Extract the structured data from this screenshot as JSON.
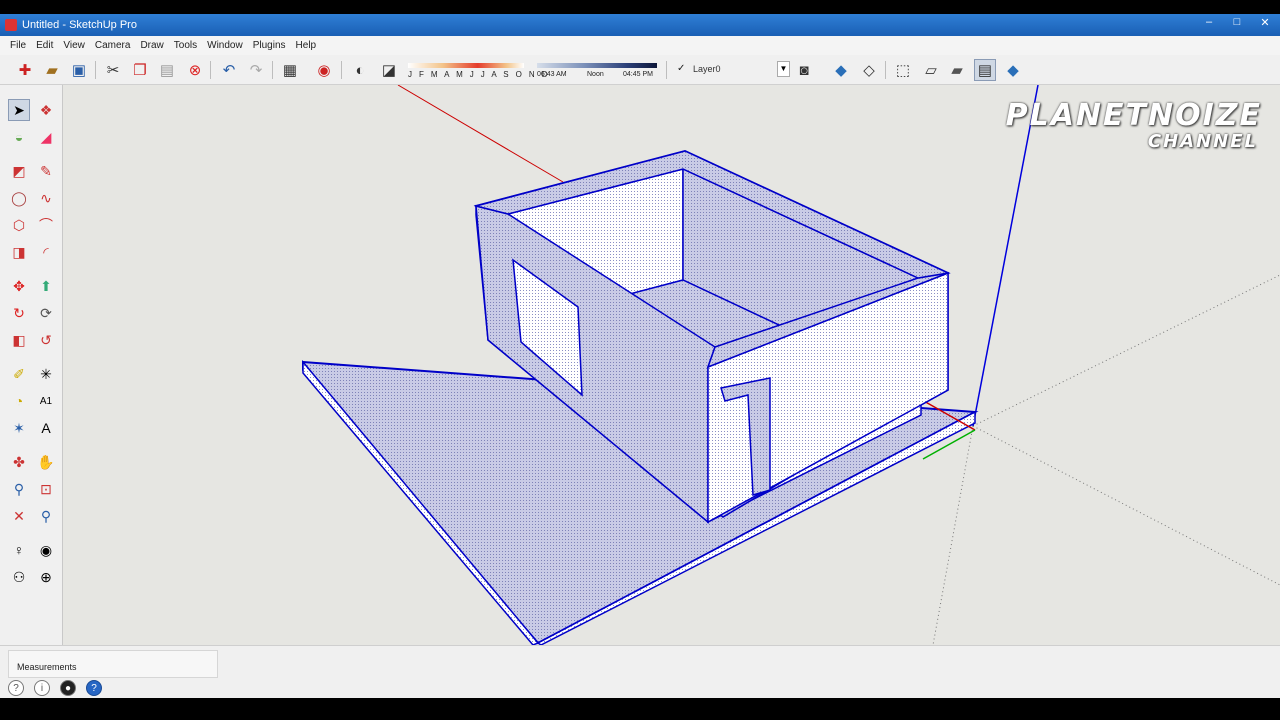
{
  "window": {
    "title": "Untitled - SketchUp Pro",
    "minimize": "–",
    "maximize": "□",
    "close": "✕"
  },
  "menu": [
    "File",
    "Edit",
    "View",
    "Camera",
    "Draw",
    "Tools",
    "Window",
    "Plugins",
    "Help"
  ],
  "shadow": {
    "months": "J F M A M J J A S O N D",
    "time_start": "06:43 AM",
    "time_mid": "Noon",
    "time_end": "04:45 PM"
  },
  "layer": {
    "check": "✓",
    "name": "Layer0",
    "dropdown": "▼"
  },
  "watermark": {
    "line1": "PLANETNOIZE",
    "line2": "CHANNEL"
  },
  "status": {
    "measurements_label": "Measurements",
    "icon_1": "?",
    "icon_2": "i",
    "icon_3": "●",
    "icon_4": "?"
  },
  "colors": {
    "edge": "#0000c8",
    "face_front": "#ffffff",
    "face_back": "#c9cbe6",
    "axis_red": "#cc0000",
    "axis_green": "#00b000",
    "axis_blue": "#0000dd"
  }
}
